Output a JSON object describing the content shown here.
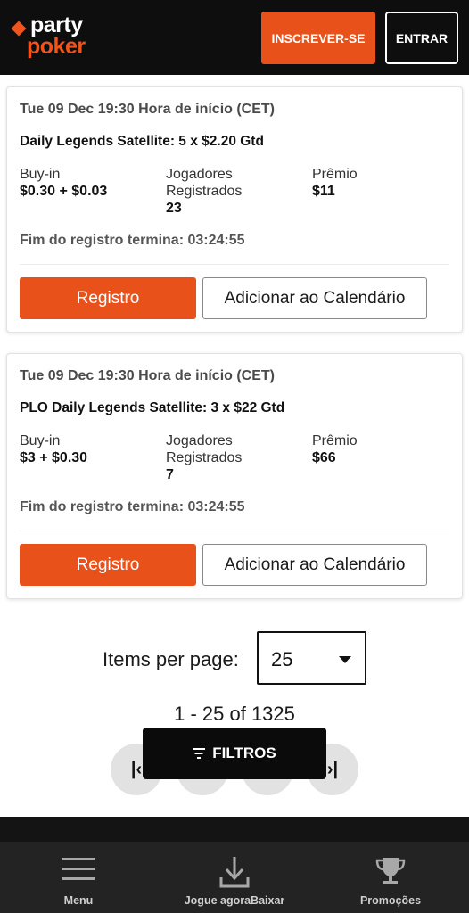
{
  "header": {
    "logo_party": "party",
    "logo_poker": "poker",
    "signup_label": "INSCREVER-SE",
    "login_label": "ENTRAR"
  },
  "tournaments": [
    {
      "time": "Tue 09 Dec 19:30 Hora de início (CET)",
      "title": "Daily Legends Satellite: 5 x $2.20 Gtd",
      "buyin_label": "Buy-in",
      "buyin_value": "$0.30 + $0.03",
      "players_label_1": "Jogadores",
      "players_label_2": "Registrados",
      "players_value": "23",
      "prize_label": "Prêmio",
      "prize_value": "$11",
      "reg_end": "Fim do registro termina: 03:24:55",
      "register_label": "Registro",
      "calendar_label": "Adicionar ao Calendário"
    },
    {
      "time": "Tue 09 Dec 19:30 Hora de início (CET)",
      "title": "PLO Daily Legends Satellite: 3 x $22 Gtd",
      "buyin_label": "Buy-in",
      "buyin_value": "$3 + $0.30",
      "players_label_1": "Jogadores",
      "players_label_2": "Registrados",
      "players_value": "7",
      "prize_label": "Prêmio",
      "prize_value": "$66",
      "reg_end": "Fim do registro termina: 03:24:55",
      "register_label": "Registro",
      "calendar_label": "Adicionar ao Calendário"
    }
  ],
  "pagination": {
    "items_per_page_label": "Items per page:",
    "items_per_page_value": "25",
    "range": "1 - 25 of 1325",
    "first_glyph": "|‹",
    "last_glyph": "›|"
  },
  "filters": {
    "label": "FILTROS"
  },
  "bottom_nav": {
    "menu_label": "Menu",
    "download_label": "Jogue agoraBaixar",
    "promos_label": "Promoções"
  },
  "colors": {
    "accent": "#e8511a",
    "header_bg": "#0e0e0e",
    "nav_bg": "#232323"
  },
  "icons": [
    "menu-icon",
    "download-icon",
    "trophy-icon",
    "filter-icon",
    "chevron-down-icon",
    "first-page-icon",
    "last-page-icon"
  ]
}
